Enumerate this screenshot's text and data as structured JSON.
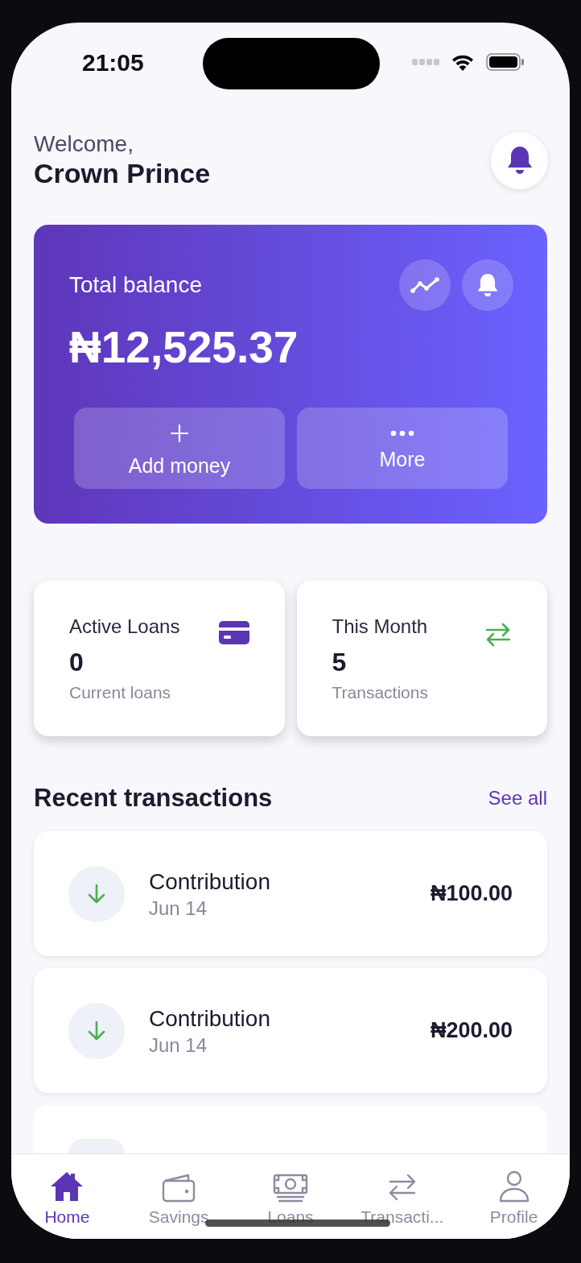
{
  "status_bar": {
    "time": "21:05"
  },
  "header": {
    "greeting": "Welcome,",
    "name": "Crown Prince"
  },
  "balance_card": {
    "label": "Total balance",
    "amount": "₦12,525.37",
    "actions": [
      {
        "label": "Add money",
        "kind": "plus"
      },
      {
        "label": "More",
        "kind": "dots"
      }
    ]
  },
  "stats": [
    {
      "title": "Active Loans",
      "value": "0",
      "caption": "Current loans",
      "kind": "card"
    },
    {
      "title": "This Month",
      "value": "5",
      "caption": "Transactions",
      "kind": "swap"
    }
  ],
  "recent": {
    "title": "Recent transactions",
    "link": "See all",
    "items": [
      {
        "title": "Contribution",
        "date": "Jun 14",
        "amount": "₦100.00"
      },
      {
        "title": "Contribution",
        "date": "Jun 14",
        "amount": "₦200.00"
      }
    ]
  },
  "nav": [
    {
      "label": "Home",
      "kind": "home",
      "selected": true
    },
    {
      "label": "Savings",
      "kind": "wallet",
      "selected": false
    },
    {
      "label": "Loans",
      "kind": "cash",
      "selected": false
    },
    {
      "label": "Transacti...",
      "kind": "swap",
      "selected": false
    },
    {
      "label": "Profile",
      "kind": "person",
      "selected": false
    }
  ]
}
